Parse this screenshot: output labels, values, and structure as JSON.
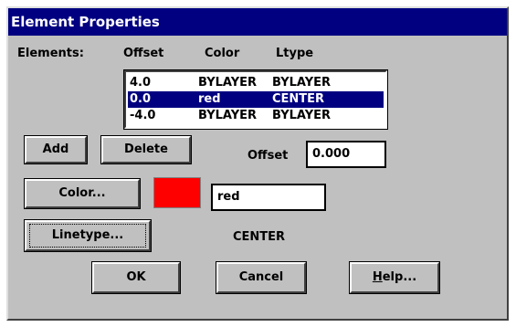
{
  "dialog": {
    "title": "Element Properties"
  },
  "elements_list": {
    "label": "Elements:",
    "headers": {
      "offset": "Offset",
      "color": "Color",
      "ltype": "Ltype"
    },
    "rows": [
      {
        "offset": "4.0",
        "color": "BYLAYER",
        "ltype": "BYLAYER",
        "selected": false
      },
      {
        "offset": "0.0",
        "color": "red",
        "ltype": "CENTER",
        "selected": true
      },
      {
        "offset": "-4.0",
        "color": "BYLAYER",
        "ltype": "BYLAYER",
        "selected": false
      }
    ]
  },
  "buttons": {
    "add": "Add",
    "delete": "Delete",
    "color": "Color...",
    "linetype": "Linetype...",
    "ok": "OK",
    "cancel": "Cancel",
    "help": "Help..."
  },
  "offset_field": {
    "label": "Offset",
    "value": "0.000"
  },
  "color_field": {
    "swatch_color": "#ff0000",
    "value": "red"
  },
  "linetype_display": {
    "value": "CENTER"
  },
  "colors": {
    "titlebar": "#000080",
    "face": "#c0c0c0",
    "selection": "#000080"
  }
}
